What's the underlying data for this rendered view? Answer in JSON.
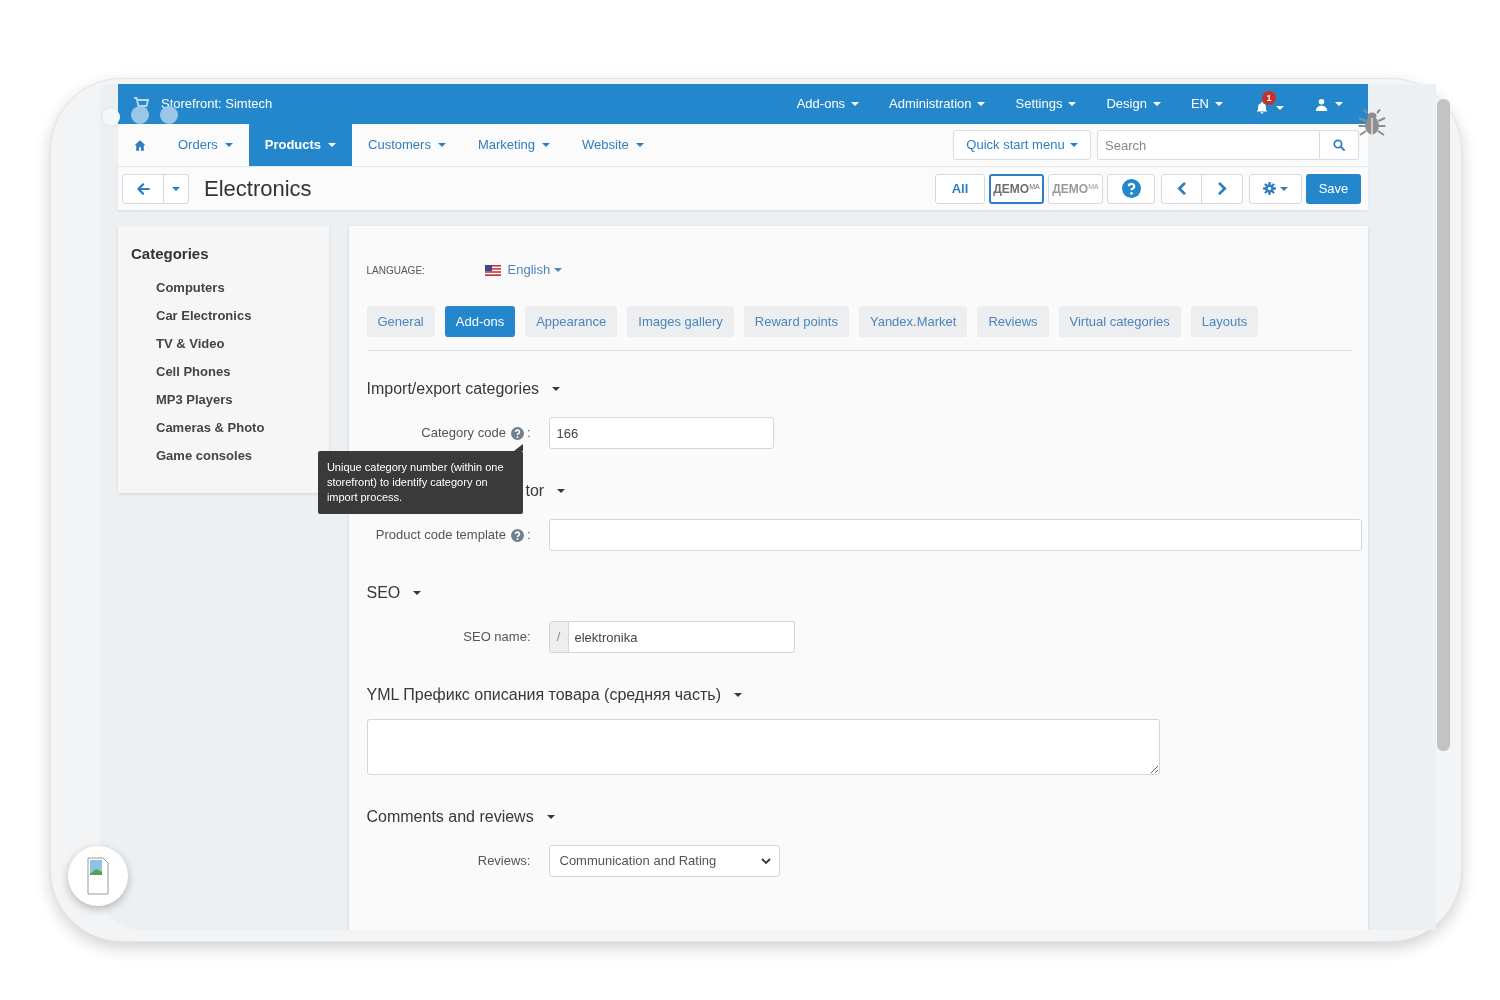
{
  "top_bar": {
    "storefront": "Storefront: Simtech",
    "menus": [
      "Add-ons",
      "Administration",
      "Settings",
      "Design",
      "EN"
    ],
    "notifications": {
      "count": "1"
    }
  },
  "nav": {
    "items": [
      {
        "label": "Orders",
        "selected": false
      },
      {
        "label": "Products",
        "selected": true
      },
      {
        "label": "Customers",
        "selected": false
      },
      {
        "label": "Marketing",
        "selected": false
      },
      {
        "label": "Website",
        "selected": false
      }
    ],
    "quick_start": "Quick start menu",
    "search": {
      "placeholder": "Search"
    }
  },
  "toolbar": {
    "title": "Electronics",
    "all_button": "All",
    "storefronts": [
      {
        "logo": "ДЕМО$^{МА}$",
        "selected": true
      },
      {
        "logo": "ДЕМО$^{МА}$",
        "selected": false
      }
    ],
    "save_button": "Save"
  },
  "sidebar": {
    "title": "Categories",
    "items": [
      "Computers",
      "Car Electronics",
      "TV & Video",
      "Cell Phones",
      "MP3 Players",
      "Cameras & Photo",
      "Game consoles"
    ]
  },
  "content": {
    "language": {
      "label": "LANGUAGE:",
      "value": "English"
    },
    "tabs": [
      {
        "label": "General",
        "selected": false
      },
      {
        "label": "Add-ons",
        "selected": true
      },
      {
        "label": "Appearance",
        "selected": false
      },
      {
        "label": "Images gallery",
        "selected": false
      },
      {
        "label": "Reward points",
        "selected": false
      },
      {
        "label": "Yandex.Market",
        "selected": false
      },
      {
        "label": "Reviews",
        "selected": false
      },
      {
        "label": "Virtual categories",
        "selected": false
      },
      {
        "label": "Layouts",
        "selected": false
      }
    ],
    "sections": [
      {
        "title": "Import/export categories",
        "hidden_by_tooltip": false,
        "fields": [
          {
            "kind": "short",
            "label": "Category code",
            "help": true,
            "label_suffix": ":",
            "value": "166",
            "tooltip": "Unique category number (within one storefront) to identify category on import process."
          }
        ]
      },
      {
        "title": "tor",
        "hidden_by_tooltip": true,
        "fields": [
          {
            "kind": "long",
            "label": "Product code template",
            "help": true,
            "label_suffix": ":"
          }
        ]
      },
      {
        "title": "SEO",
        "hidden_by_tooltip": false,
        "fields": [
          {
            "kind": "prefixed",
            "label": "SEO name:",
            "help": false,
            "prefix": "/",
            "value": "elektronika"
          }
        ]
      },
      {
        "title": "YML Префикс описания товара (средняя часть)",
        "hidden_by_tooltip": false,
        "fields": [
          {
            "kind": "textarea"
          }
        ]
      },
      {
        "title": "Comments and reviews",
        "hidden_by_tooltip": false,
        "fields": [
          {
            "kind": "select",
            "label": "Reviews:",
            "help": false,
            "value": "Communication and Rating"
          }
        ]
      }
    ]
  }
}
